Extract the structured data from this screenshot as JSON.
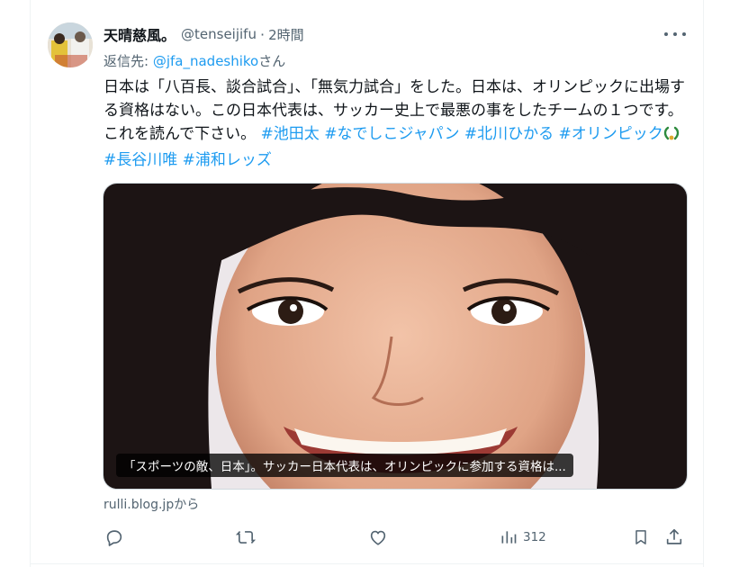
{
  "tweet": {
    "display_name": "天晴慈風。",
    "handle": "@tenseijifu",
    "separator": "·",
    "time": "2時間",
    "reply_prefix": "返信先: ",
    "reply_mention": "@jfa_nadeshiko",
    "reply_suffix": "さん",
    "text_main": "日本は「八百長、談合試合」、「無気力試合」をした。日本は、オリンピックに出場する資格はない。この日本代表は、サッカー史上で最悪の事をしたチームの１つです。これを読んで下さい。",
    "hashtags": [
      "#池田太",
      "#なでしこジャパン",
      "#北川ひかる",
      "#オリンピック",
      "#長谷川唯",
      "#浦和レッズ"
    ],
    "olympic_emoji": "laurel-wreath"
  },
  "card": {
    "caption": "「スポーツの敵、日本」。サッカー日本代表は、オリンピックに参加する資格は...",
    "source": "rulli.blog.jpから"
  },
  "actions": {
    "views_count": "312"
  },
  "icons": [
    "more-icon",
    "reply-icon",
    "retweet-icon",
    "like-icon",
    "views-icon",
    "bookmark-icon",
    "share-icon"
  ],
  "colors": {
    "accent": "#1d9bf0",
    "text": "#0f1419",
    "muted": "#536471"
  }
}
